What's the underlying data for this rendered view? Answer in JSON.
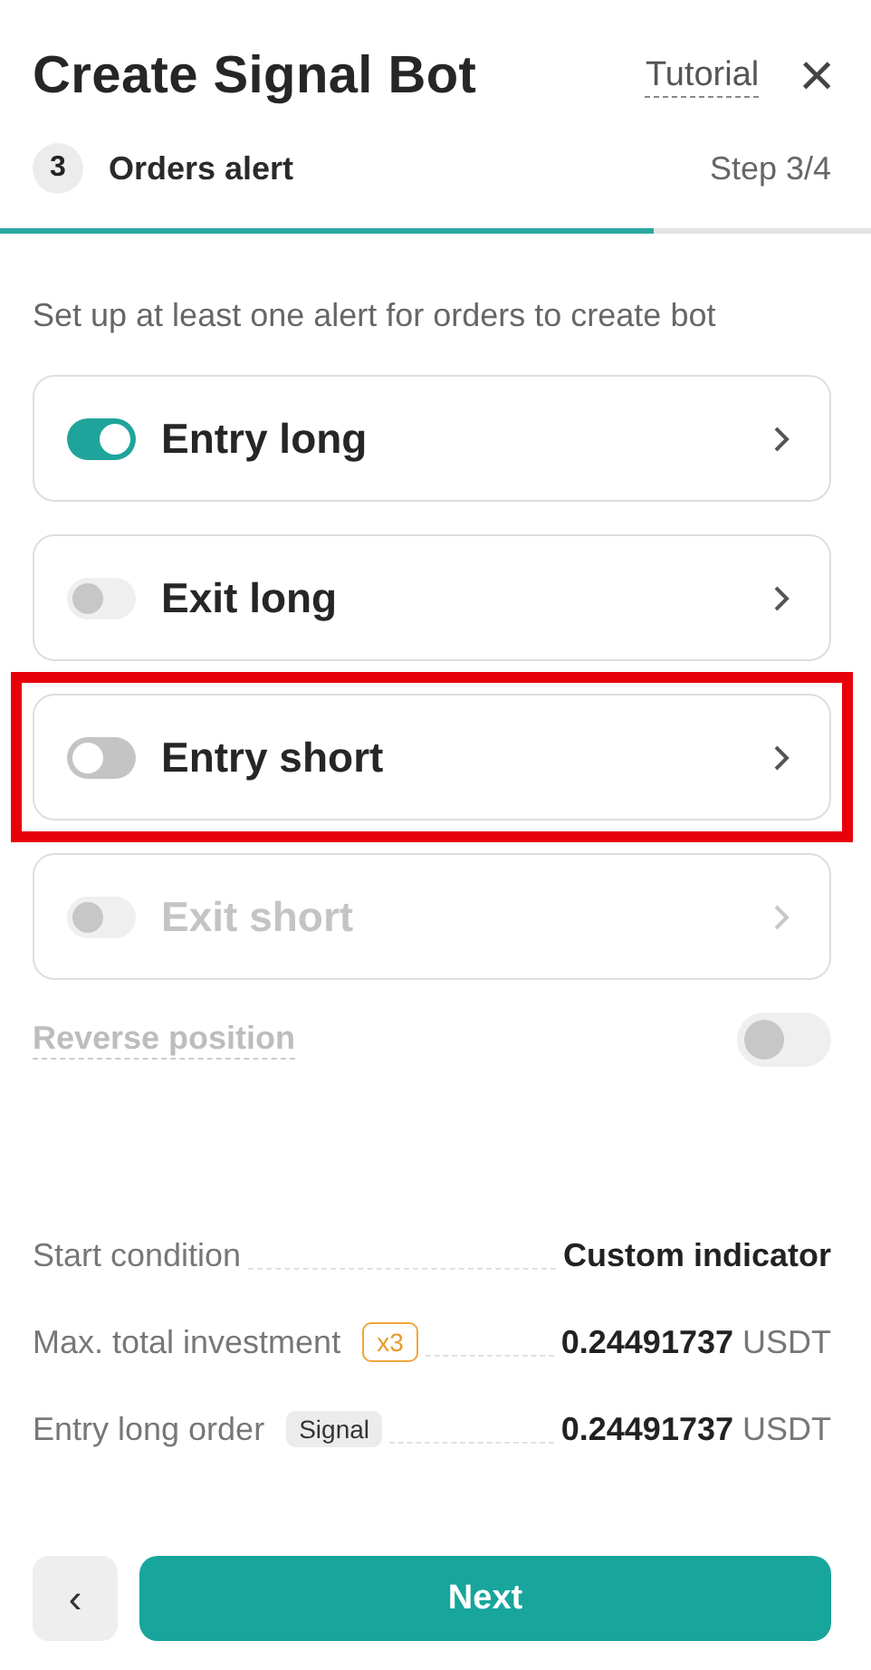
{
  "header": {
    "title": "Create Signal Bot",
    "tutorial_link": "Tutorial",
    "close_icon": "×"
  },
  "step": {
    "number": "3",
    "title": "Orders alert",
    "counter": "Step 3/4",
    "level": 0.75
  },
  "description": "Set up at least one alert for orders to create bot",
  "alerts": [
    {
      "label": "Entry long",
      "on": true,
      "toggle_disabled": false,
      "disabled": false,
      "highlighted": false
    },
    {
      "label": "Exit long",
      "on": false,
      "toggle_disabled": true,
      "disabled": false,
      "highlighted": false
    },
    {
      "label": "Entry short",
      "on": false,
      "toggle_disabled": false,
      "disabled": false,
      "highlighted": true
    },
    {
      "label": "Exit short",
      "on": false,
      "toggle_disabled": true,
      "disabled": true,
      "highlighted": false
    }
  ],
  "reverse_position": {
    "label": "Reverse position",
    "on": false,
    "disabled": true
  },
  "summary": [
    {
      "label": "Start condition",
      "value": "Custom indicator"
    },
    {
      "label": "Max. total investment",
      "badge": {
        "text": "x3",
        "kind": "outline"
      },
      "value": "0.24491737",
      "unit": "USDT"
    },
    {
      "label": "Entry long order",
      "badge": {
        "text": "Signal",
        "kind": "filled"
      },
      "value": "0.24491737",
      "unit": "USDT"
    }
  ],
  "footer": {
    "back": "‹",
    "next": "Next"
  }
}
